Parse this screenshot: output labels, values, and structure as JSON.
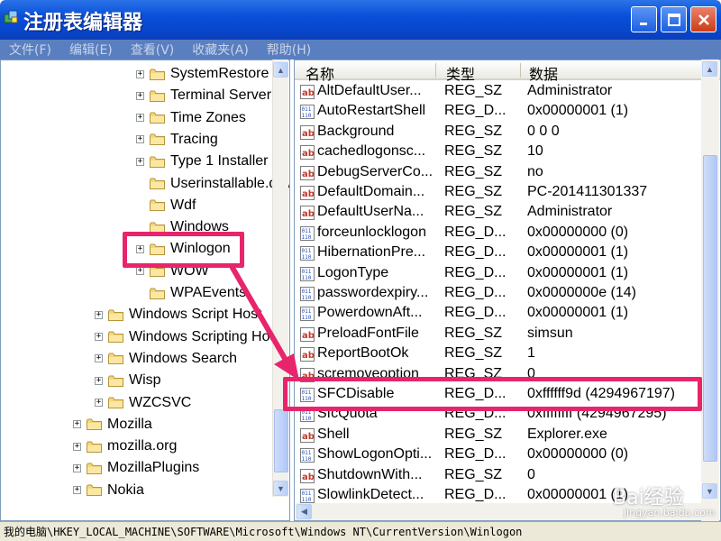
{
  "window": {
    "title": "注册表编辑器",
    "minimize_icon": "minimize-icon",
    "maximize_icon": "maximize-icon",
    "close_icon": "close-icon",
    "titlebar_color": "#0a4fd9"
  },
  "menu": [
    "文件(F)",
    "编辑(E)",
    "查看(V)",
    "收藏夹(A)",
    "帮助(H)"
  ],
  "tree": [
    {
      "label": "SystemRestore",
      "expander": "+",
      "indent": 2
    },
    {
      "label": "Terminal Server",
      "expander": "+",
      "indent": 2
    },
    {
      "label": "Time Zones",
      "expander": "+",
      "indent": 2
    },
    {
      "label": "Tracing",
      "expander": "+",
      "indent": 2
    },
    {
      "label": "Type 1 Installer",
      "expander": "+",
      "indent": 2
    },
    {
      "label": "Userinstallable.drivers",
      "expander": "",
      "indent": 2
    },
    {
      "label": "Wdf",
      "expander": "",
      "indent": 2
    },
    {
      "label": "Windows",
      "expander": "",
      "indent": 2
    },
    {
      "label": "Winlogon",
      "expander": "+",
      "indent": 2,
      "highlight": true
    },
    {
      "label": "WOW",
      "expander": "+",
      "indent": 2
    },
    {
      "label": "WPAEvents",
      "expander": "",
      "indent": 2
    },
    {
      "label": "Windows Script Host",
      "expander": "+",
      "indent": 1
    },
    {
      "label": "Windows Scripting Host",
      "expander": "+",
      "indent": 1
    },
    {
      "label": "Windows Search",
      "expander": "+",
      "indent": 1
    },
    {
      "label": "Wisp",
      "expander": "+",
      "indent": 1
    },
    {
      "label": "WZCSVC",
      "expander": "+",
      "indent": 1
    },
    {
      "label": "Mozilla",
      "expander": "+",
      "indent": 0
    },
    {
      "label": "mozilla.org",
      "expander": "+",
      "indent": 0
    },
    {
      "label": "MozillaPlugins",
      "expander": "+",
      "indent": 0
    },
    {
      "label": "Nokia",
      "expander": "+",
      "indent": 0
    }
  ],
  "list": {
    "columns": [
      "名称",
      "类型",
      "数据"
    ],
    "rows": [
      {
        "name": "AltDefaultUser...",
        "type": "REG_SZ",
        "data": "Administrator",
        "icon": "string-value-icon"
      },
      {
        "name": "AutoRestartShell",
        "type": "REG_D...",
        "data": "0x00000001 (1)",
        "icon": "binary-value-icon"
      },
      {
        "name": "Background",
        "type": "REG_SZ",
        "data": "0 0 0",
        "icon": "string-value-icon"
      },
      {
        "name": "cachedlogonsc...",
        "type": "REG_SZ",
        "data": "10",
        "icon": "string-value-icon"
      },
      {
        "name": "DebugServerCo...",
        "type": "REG_SZ",
        "data": "no",
        "icon": "string-value-icon"
      },
      {
        "name": "DefaultDomain...",
        "type": "REG_SZ",
        "data": "PC-201411301337",
        "icon": "string-value-icon"
      },
      {
        "name": "DefaultUserNa...",
        "type": "REG_SZ",
        "data": "Administrator",
        "icon": "string-value-icon"
      },
      {
        "name": "forceunlocklogon",
        "type": "REG_D...",
        "data": "0x00000000 (0)",
        "icon": "binary-value-icon"
      },
      {
        "name": "HibernationPre...",
        "type": "REG_D...",
        "data": "0x00000001 (1)",
        "icon": "binary-value-icon"
      },
      {
        "name": "LogonType",
        "type": "REG_D...",
        "data": "0x00000001 (1)",
        "icon": "binary-value-icon"
      },
      {
        "name": "passwordexpiry...",
        "type": "REG_D...",
        "data": "0x0000000e (14)",
        "icon": "binary-value-icon"
      },
      {
        "name": "PowerdownAft...",
        "type": "REG_D...",
        "data": "0x00000001 (1)",
        "icon": "binary-value-icon"
      },
      {
        "name": "PreloadFontFile",
        "type": "REG_SZ",
        "data": "simsun",
        "icon": "string-value-icon"
      },
      {
        "name": "ReportBootOk",
        "type": "REG_SZ",
        "data": "1",
        "icon": "string-value-icon"
      },
      {
        "name": "scremoveoption",
        "type": "REG_SZ",
        "data": "0",
        "icon": "string-value-icon"
      },
      {
        "name": "SFCDisable",
        "type": "REG_D...",
        "data": "0xffffff9d (4294967197)",
        "icon": "binary-value-icon",
        "highlight": true
      },
      {
        "name": "SfcQuota",
        "type": "REG_D...",
        "data": "0xffffffff (4294967295)",
        "icon": "binary-value-icon"
      },
      {
        "name": "Shell",
        "type": "REG_SZ",
        "data": "Explorer.exe",
        "icon": "string-value-icon"
      },
      {
        "name": "ShowLogonOpti...",
        "type": "REG_D...",
        "data": "0x00000000 (0)",
        "icon": "binary-value-icon"
      },
      {
        "name": "ShutdownWith...",
        "type": "REG_SZ",
        "data": "0",
        "icon": "string-value-icon"
      },
      {
        "name": "SlowlinkDetect...",
        "type": "REG_D...",
        "data": "0x00000001 (1)",
        "icon": "binary-value-icon"
      }
    ]
  },
  "status": "我的电脑\\HKEY_LOCAL_MACHINE\\SOFTWARE\\Microsoft\\Windows NT\\CurrentVersion\\Winlogon",
  "watermark": {
    "logo": "Bai经验",
    "url": "jingyan.baidu.com"
  },
  "highlight_color": "#e8256c"
}
